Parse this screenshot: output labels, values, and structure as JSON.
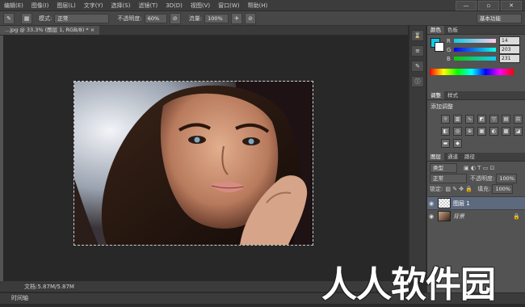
{
  "menu": [
    "编辑(E)",
    "图像(I)",
    "图层(L)",
    "文字(Y)",
    "选择(S)",
    "滤镜(T)",
    "3D(D)",
    "视图(V)",
    "窗口(W)",
    "帮助(H)"
  ],
  "window_controls": [
    "—",
    "▫",
    "✕"
  ],
  "options": {
    "mode_label": "模式:",
    "mode_value": "正常",
    "opacity_label": "不透明度:",
    "opacity_value": "60%",
    "flow_label": "流量:",
    "flow_value": "100%",
    "workspace": "基本功能"
  },
  "document_tab": "...jpg @ 33.3% (图层 1, RGB/8) * ×",
  "status": {
    "doc_size": "文档:5.87M/5.87M",
    "timeline": "时间轴"
  },
  "color_panel": {
    "tabs": [
      "颜色",
      "色板"
    ],
    "channels": [
      {
        "name": "R",
        "value": "14"
      },
      {
        "name": "G",
        "value": "203"
      },
      {
        "name": "B",
        "value": "231"
      }
    ],
    "foreground_color": "#0ecbe7"
  },
  "adjust_panel": {
    "tabs": [
      "调整",
      "样式"
    ],
    "title": "添加调整"
  },
  "layers_panel": {
    "tabs": [
      "图层",
      "通道",
      "路径"
    ],
    "filter": "类型",
    "blend_mode": "正常",
    "opacity_label": "不透明度:",
    "opacity_value": "100%",
    "lock_label": "锁定:",
    "fill_label": "填充:",
    "fill_value": "100%",
    "layers": [
      {
        "name": "图层 1"
      },
      {
        "name": "背景"
      }
    ]
  },
  "watermark": "人人软件园"
}
